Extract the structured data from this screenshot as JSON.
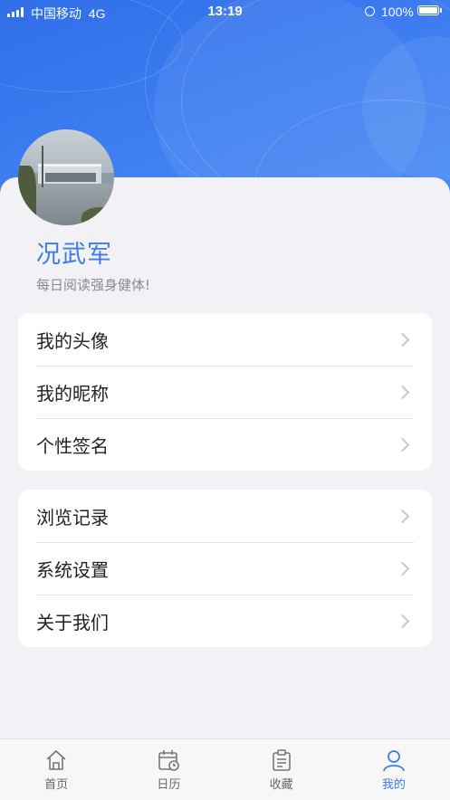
{
  "status_bar": {
    "carrier": "中国移动",
    "network": "4G",
    "time": "13:19",
    "battery": "100%"
  },
  "profile": {
    "name": "况武军",
    "signature": "每日阅读强身健体!"
  },
  "menu_group_1": [
    {
      "label": "我的头像"
    },
    {
      "label": "我的昵称"
    },
    {
      "label": "个性签名"
    }
  ],
  "menu_group_2": [
    {
      "label": "浏览记录"
    },
    {
      "label": "系统设置"
    },
    {
      "label": "关于我们"
    }
  ],
  "tabs": [
    {
      "label": "首页",
      "icon": "home-icon",
      "active": false
    },
    {
      "label": "日历",
      "icon": "calendar-icon",
      "active": false
    },
    {
      "label": "收藏",
      "icon": "clipboard-icon",
      "active": false
    },
    {
      "label": "我的",
      "icon": "user-icon",
      "active": true
    }
  ],
  "colors": {
    "accent": "#3b7ee8",
    "header": "#3c7cf0",
    "background": "#f2f1f6"
  }
}
